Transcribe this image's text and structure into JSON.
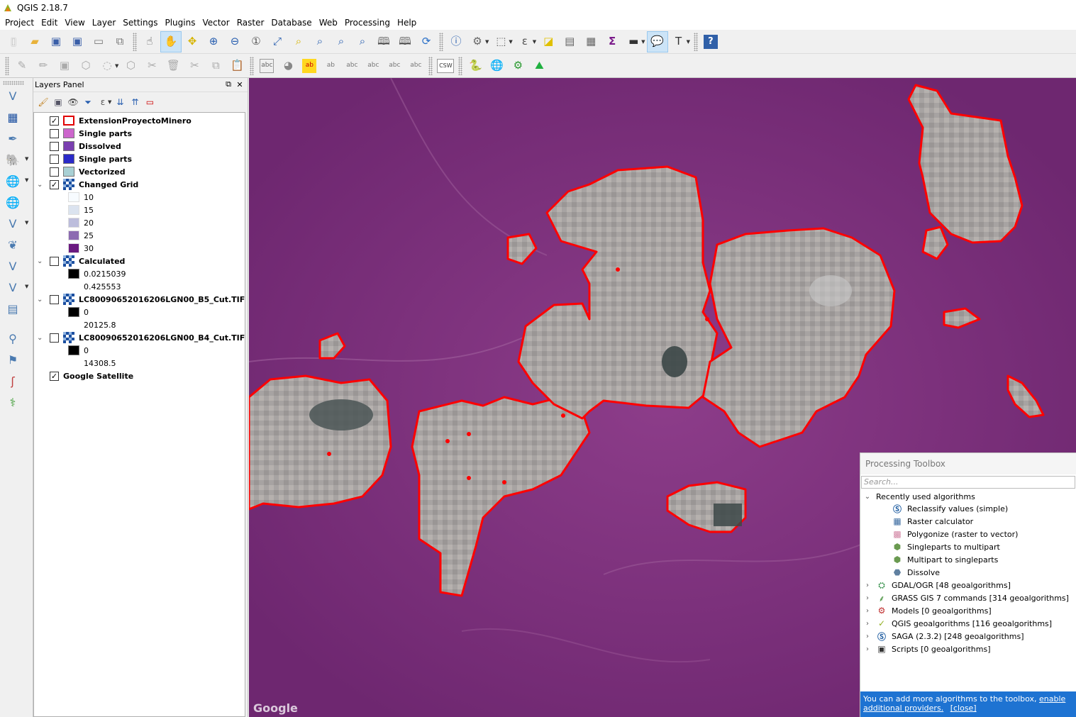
{
  "window": {
    "title": "QGIS 2.18.7"
  },
  "menu": [
    "Project",
    "Edit",
    "View",
    "Layer",
    "Settings",
    "Plugins",
    "Vector",
    "Raster",
    "Database",
    "Web",
    "Processing",
    "Help"
  ],
  "toolbar2": {
    "csw_label": "CSW"
  },
  "layers_panel": {
    "title": "Layers Panel",
    "layers": [
      {
        "name": "ExtensionProyectoMinero",
        "checked": true,
        "swatch": "#ffffff",
        "swatch_border": "#e00000"
      },
      {
        "name": "Single parts",
        "checked": false,
        "swatch": "#cc66cc"
      },
      {
        "name": "Dissolved",
        "checked": false,
        "swatch": "#7a3fb0"
      },
      {
        "name": "Single parts",
        "checked": false,
        "swatch": "#2a2ac8"
      },
      {
        "name": "Vectorized",
        "checked": false,
        "swatch": "#a8d0d4"
      },
      {
        "name": "Changed Grid",
        "checked": true,
        "expanded": true,
        "raster": true,
        "classes": [
          {
            "label": "10",
            "color": "#f7fbff"
          },
          {
            "label": "15",
            "color": "#dbe3ef"
          },
          {
            "label": "20",
            "color": "#bcbddc"
          },
          {
            "label": "25",
            "color": "#8c6bb1"
          },
          {
            "label": "30",
            "color": "#6a1a80"
          }
        ]
      },
      {
        "name": "Calculated",
        "checked": false,
        "expanded": true,
        "raster": true,
        "min": "0.0215039",
        "max": "0.425553"
      },
      {
        "name": "LC80090652016206LGN00_B5_Cut.TIF",
        "checked": false,
        "expanded": true,
        "raster": true,
        "min": "0",
        "max": "20125.8"
      },
      {
        "name": "LC80090652016206LGN00_B4_Cut.TIF",
        "checked": false,
        "expanded": true,
        "raster": true,
        "min": "0",
        "max": "14308.5"
      },
      {
        "name": "Google Satellite",
        "checked": true
      }
    ]
  },
  "map": {
    "attribution": "Google",
    "overlay_color": "#7a2f77",
    "boundary_color": "#ff0000"
  },
  "processing_toolbox": {
    "title": "Processing Toolbox",
    "search_placeholder": "Search...",
    "recent": {
      "label": "Recently used algorithms",
      "items": [
        {
          "label": "Reclassify values (simple)",
          "icon": "saga-icon"
        },
        {
          "label": "Raster calculator",
          "icon": "raster-calculator-icon"
        },
        {
          "label": "Polygonize (raster to vector)",
          "icon": "polygonize-icon"
        },
        {
          "label": "Singleparts to multipart",
          "icon": "singleparts-icon"
        },
        {
          "label": "Multipart to singleparts",
          "icon": "multipart-icon"
        },
        {
          "label": "Dissolve",
          "icon": "dissolve-icon"
        }
      ]
    },
    "providers": [
      {
        "label": "GDAL/OGR [48 geoalgorithms]",
        "icon": "gdal-icon"
      },
      {
        "label": "GRASS GIS 7 commands [314 geoalgorithms]",
        "icon": "grass-icon"
      },
      {
        "label": "Models [0 geoalgorithms]",
        "icon": "models-icon"
      },
      {
        "label": "QGIS geoalgorithms [116 geoalgorithms]",
        "icon": "qgis-icon"
      },
      {
        "label": "SAGA (2.3.2) [248 geoalgorithms]",
        "icon": "saga-icon"
      },
      {
        "label": "Scripts [0 geoalgorithms]",
        "icon": "scripts-icon"
      }
    ],
    "footer_text": "You can add more algorithms to the toolbox,",
    "footer_link": "enable additional providers.",
    "footer_close": "[close]"
  }
}
